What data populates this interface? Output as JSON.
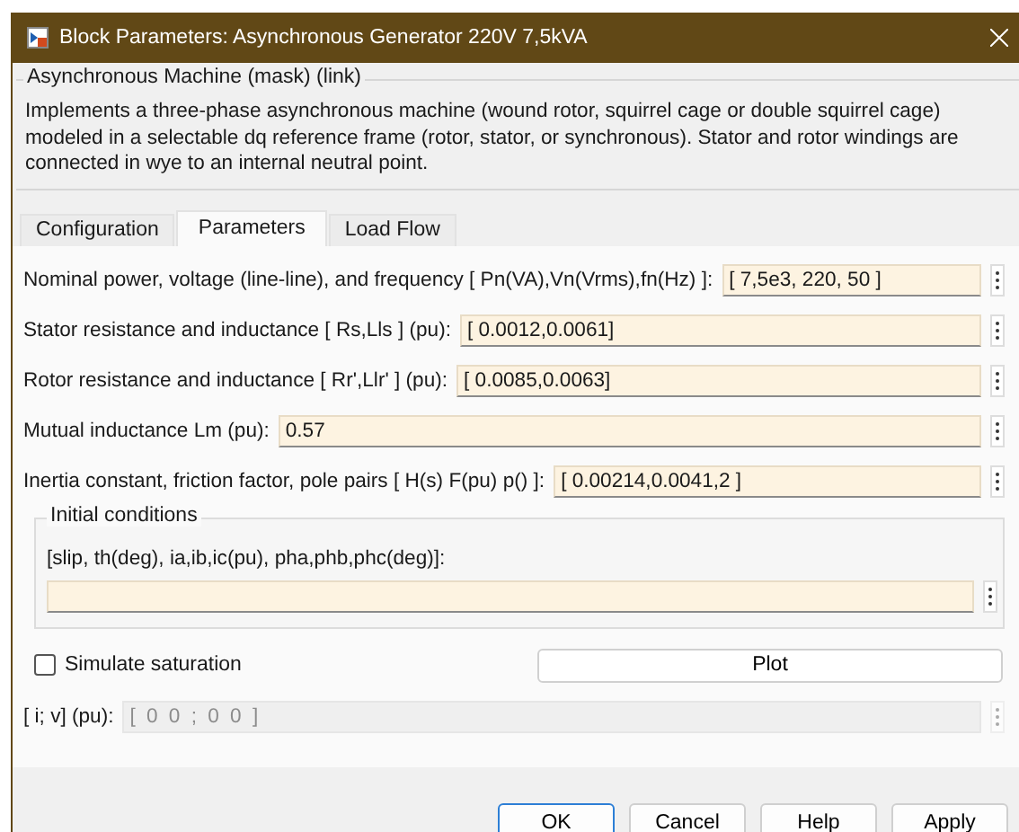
{
  "window": {
    "title": "Block Parameters: Asynchronous Generator 220V 7,5kVA"
  },
  "mask": {
    "title": "Asynchronous Machine (mask) (link)",
    "description": "Implements a three-phase asynchronous machine (wound rotor, squirrel cage or double squirrel cage) modeled in a selectable dq reference frame (rotor, stator, or synchronous). Stator and rotor windings are connected in wye to an internal neutral point."
  },
  "tabs": [
    {
      "label": "Configuration",
      "selected": false
    },
    {
      "label": "Parameters",
      "selected": true
    },
    {
      "label": "Load Flow",
      "selected": false
    }
  ],
  "parameters": [
    {
      "label": "Nominal power, voltage (line-line), and frequency  [ Pn(VA),Vn(Vrms),fn(Hz) ]:",
      "value": "[ 7,5e3, 220, 50 ]"
    },
    {
      "label": "Stator resistance and inductance  [ Rs,Lls ] (pu):",
      "value": "[ 0.0012,0.0061]"
    },
    {
      "label": "Rotor resistance and inductance  [ Rr',Llr' ] (pu):",
      "value": "[ 0.0085,0.0063]"
    },
    {
      "label": "Mutual inductance Lm (pu):",
      "value": "0.57"
    },
    {
      "label": "Inertia constant, friction factor, pole pairs [ H(s) F(pu)  p() ]:",
      "value": "[ 0.00214,0.0041,2 ]"
    }
  ],
  "initial_conditions": {
    "title": "Initial conditions",
    "label": "[slip, th(deg), ia,ib,ic(pu), pha,phb,phc(deg)]:"
  },
  "saturation": {
    "label": "Simulate saturation",
    "checked": false
  },
  "plot_button": "Plot",
  "saturation_data": {
    "label": "[ i; v] (pu):",
    "value": "[ 0 0 ; 0 0 ]",
    "disabled": true
  },
  "buttons": [
    "OK",
    "Cancel",
    "Help",
    "Apply"
  ]
}
